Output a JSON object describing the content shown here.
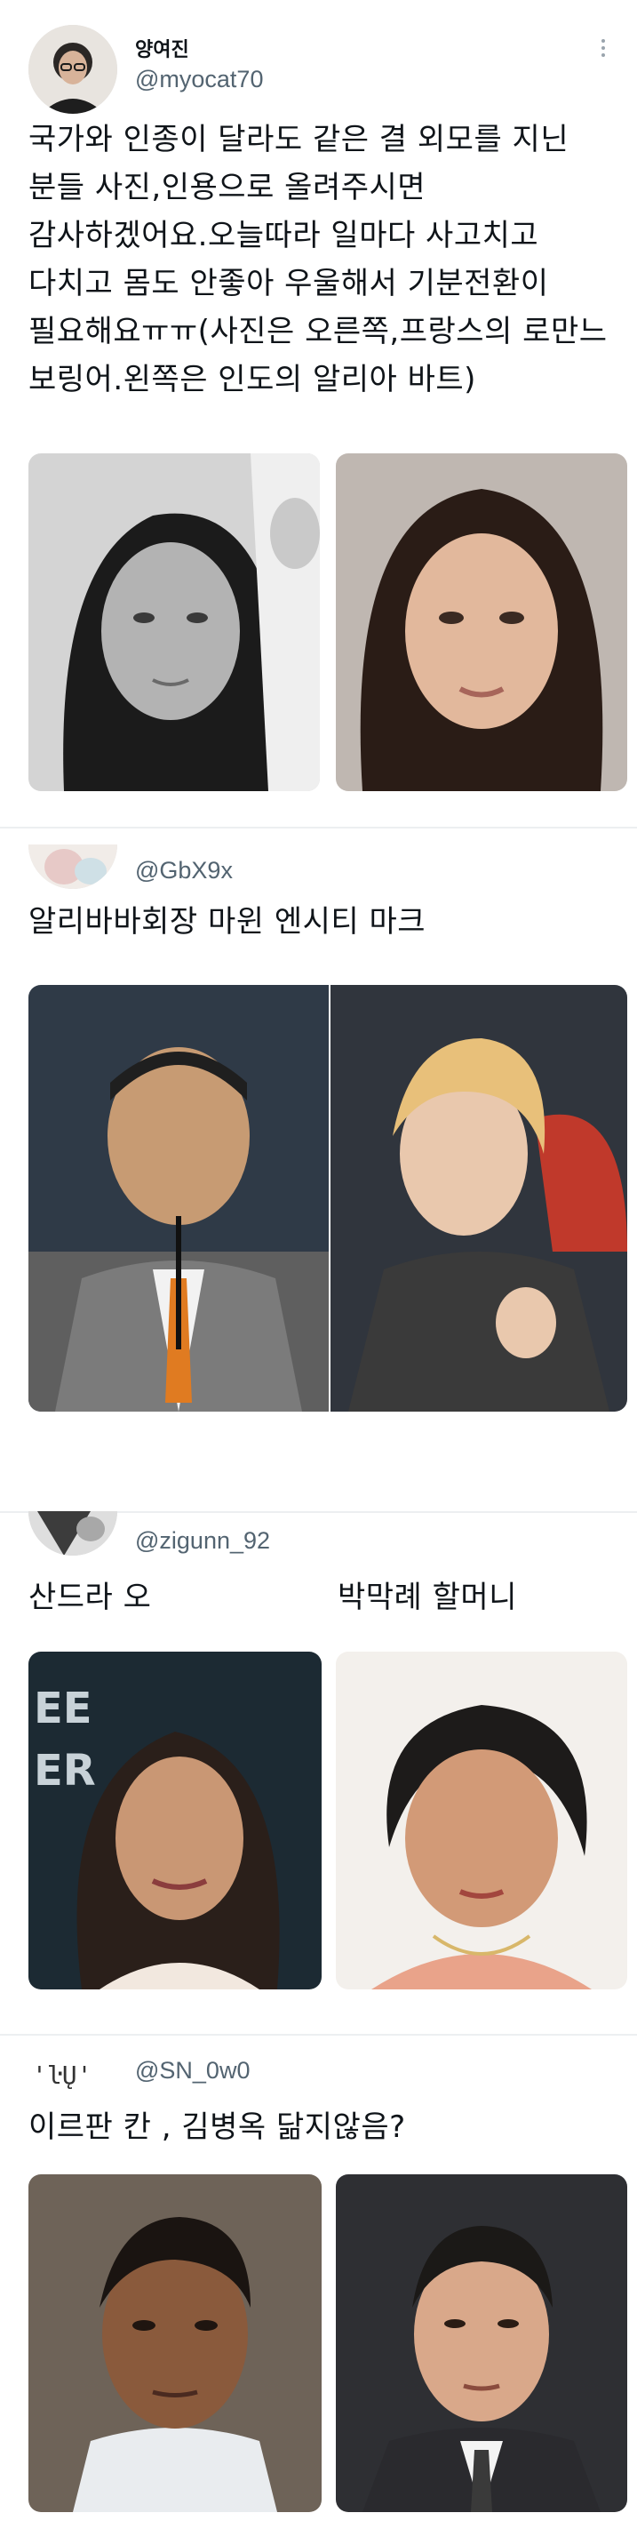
{
  "tweet1": {
    "name": "양여진",
    "handle": "@myocat70",
    "lines": [
      "국가와 인종이 달라도 같은 결 외모를 지닌",
      "분들 사진,인용으로 올려주시면",
      "감사하겠어요.오늘따라 일마다 사고치고",
      "다치고 몸도 안좋아 우울해서 기분전환이",
      "필요해요ㅠㅠ(사진은 오른쪽,프랑스의 로만느",
      "보링어.왼쪽은 인도의 알리아 바트)"
    ]
  },
  "tweet2": {
    "handle": "@GbX9x",
    "text": "알리바바회장 마윈  엔시티 마크"
  },
  "tweet3": {
    "handle": "@zigunn_92",
    "text_left": "산드라 오",
    "text_right": "박막례 할머니"
  },
  "tweet4": {
    "handle": "@SN_0w0",
    "text": "이르판 칸 , 김병옥 닮지않음?"
  },
  "colors": {
    "text": "#0f1419",
    "handle": "#536471",
    "divider": "#eceff1"
  }
}
